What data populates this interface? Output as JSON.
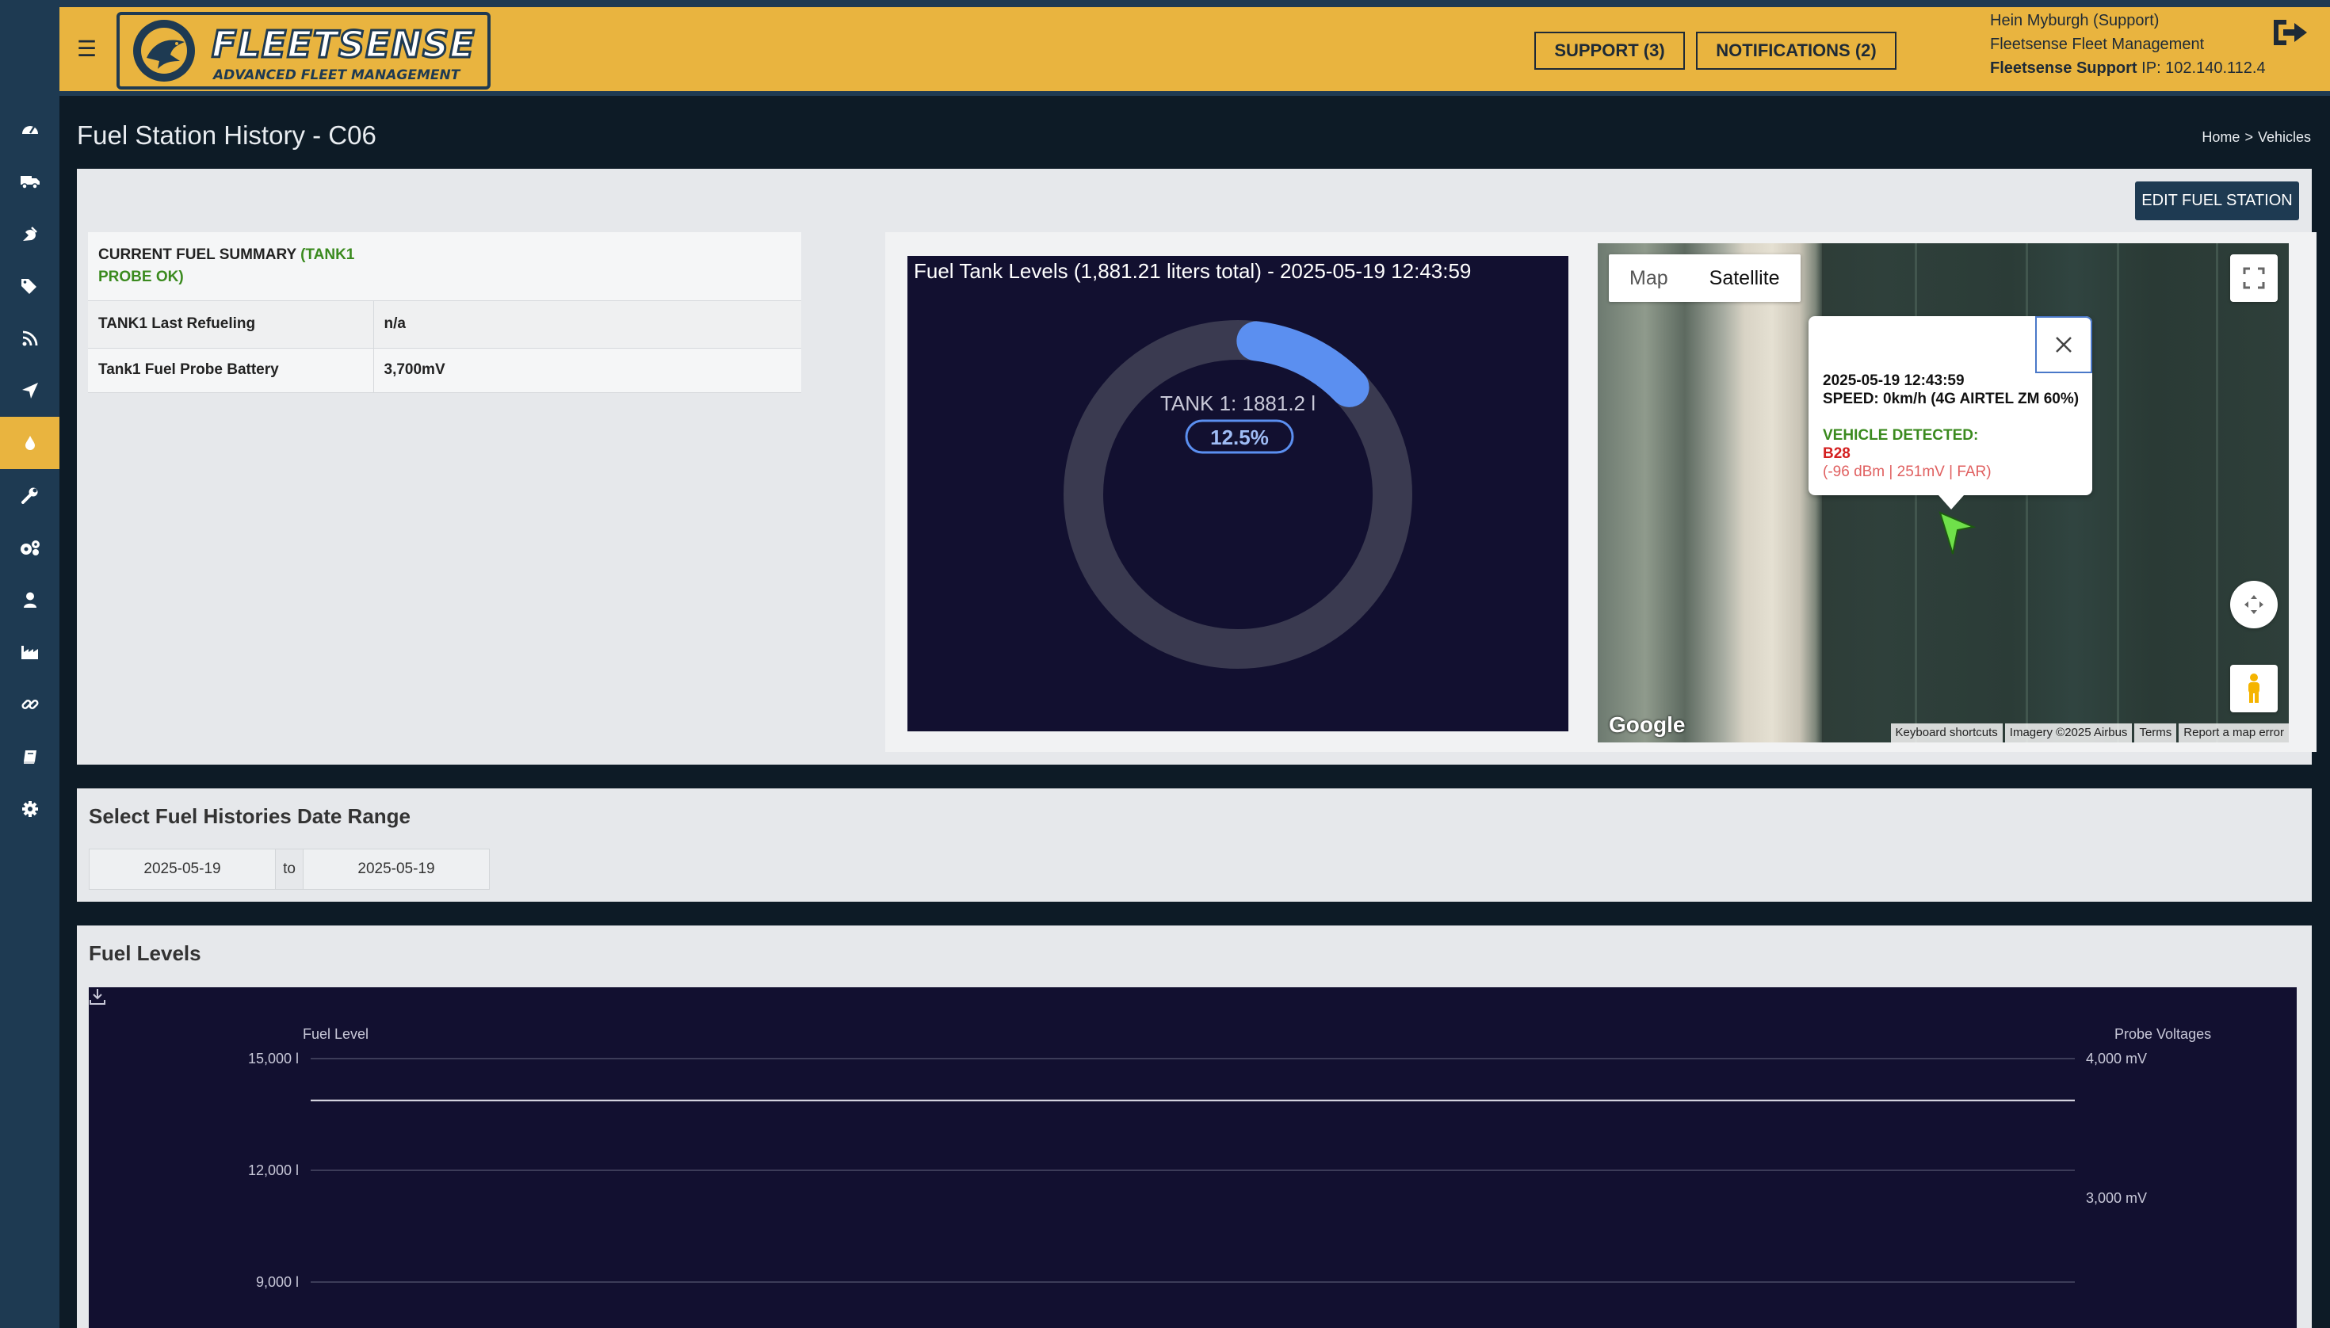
{
  "header": {
    "brand_name": "FLEETSENSE",
    "brand_tagline": "ADVANCED FLEET MANAGEMENT",
    "support_button": "SUPPORT (3)",
    "notifications_button": "NOTIFICATIONS (2)",
    "user_name": "Hein Myburgh (Support)",
    "company": "Fleetsense Fleet Management",
    "role": "Fleetsense Support",
    "ip_label": " IP: 102.140.112.4"
  },
  "page": {
    "title": "Fuel Station History - C06",
    "breadcrumb_home": "Home",
    "breadcrumb_sep": ">",
    "breadcrumb_current": "Vehicles",
    "edit_button": "EDIT FUEL STATION"
  },
  "summary": {
    "heading": "CURRENT FUEL SUMMARY ",
    "status": "(TANK1 PROBE OK)",
    "rows": [
      {
        "label": "TANK1 Last Refueling",
        "value": "n/a"
      },
      {
        "label": "Tank1 Fuel Probe Battery",
        "value": "3,700mV"
      }
    ]
  },
  "gauge": {
    "title": "Fuel Tank Levels (1,881.21 liters total) - 2025-05-19 12:43:59",
    "tank_label": "TANK 1: 1881.2 l",
    "percent_label": "12.5%",
    "percent": 12.5,
    "track_color": "#3a3a50",
    "fill_color": "#5b8ff0"
  },
  "map": {
    "map_tab": "Map",
    "satellite_tab": "Satellite",
    "info_timestamp": "2025-05-19 12:43:59",
    "info_speed": "SPEED: 0km/h (4G AIRTEL ZM 60%)",
    "info_detected": "VEHICLE DETECTED:",
    "info_vehicle": "B28",
    "info_signal": "(-96 dBm | 251mV | FAR)",
    "attribution": "Google",
    "footer_links": [
      "Keyboard shortcuts",
      "Imagery ©2025 Airbus",
      "Terms",
      "Report a map error"
    ]
  },
  "date_range": {
    "title": "Select Fuel Histories Date Range",
    "from": "2025-05-19",
    "to_label": "to",
    "to": "2025-05-19"
  },
  "fuel_levels": {
    "title": "Fuel Levels"
  },
  "chart_data": {
    "type": "line",
    "title": "",
    "ylabel": "Fuel Level",
    "y2label": "Probe Voltages",
    "y_ticks": [
      "15,000 l",
      "12,000 l",
      "9,000 l"
    ],
    "y_tick_values": [
      15000,
      12000,
      9000
    ],
    "y2_ticks": [
      "4,000 mV",
      "3,000 mV"
    ],
    "y2_tick_values": [
      4000,
      3000
    ],
    "series": [
      {
        "axis": "y2",
        "values": [
          3700,
          3700
        ]
      }
    ]
  },
  "icons": {
    "nav": [
      "dashboard-icon",
      "truck-icon",
      "satellite-dish-icon",
      "tags-icon",
      "rss-icon",
      "location-arrow-icon",
      "fuel-drop-icon",
      "wrench-icon",
      "cogs-icon",
      "user-icon",
      "industry-chart-icon",
      "link-icon",
      "book-icon",
      "gear-icon"
    ]
  }
}
